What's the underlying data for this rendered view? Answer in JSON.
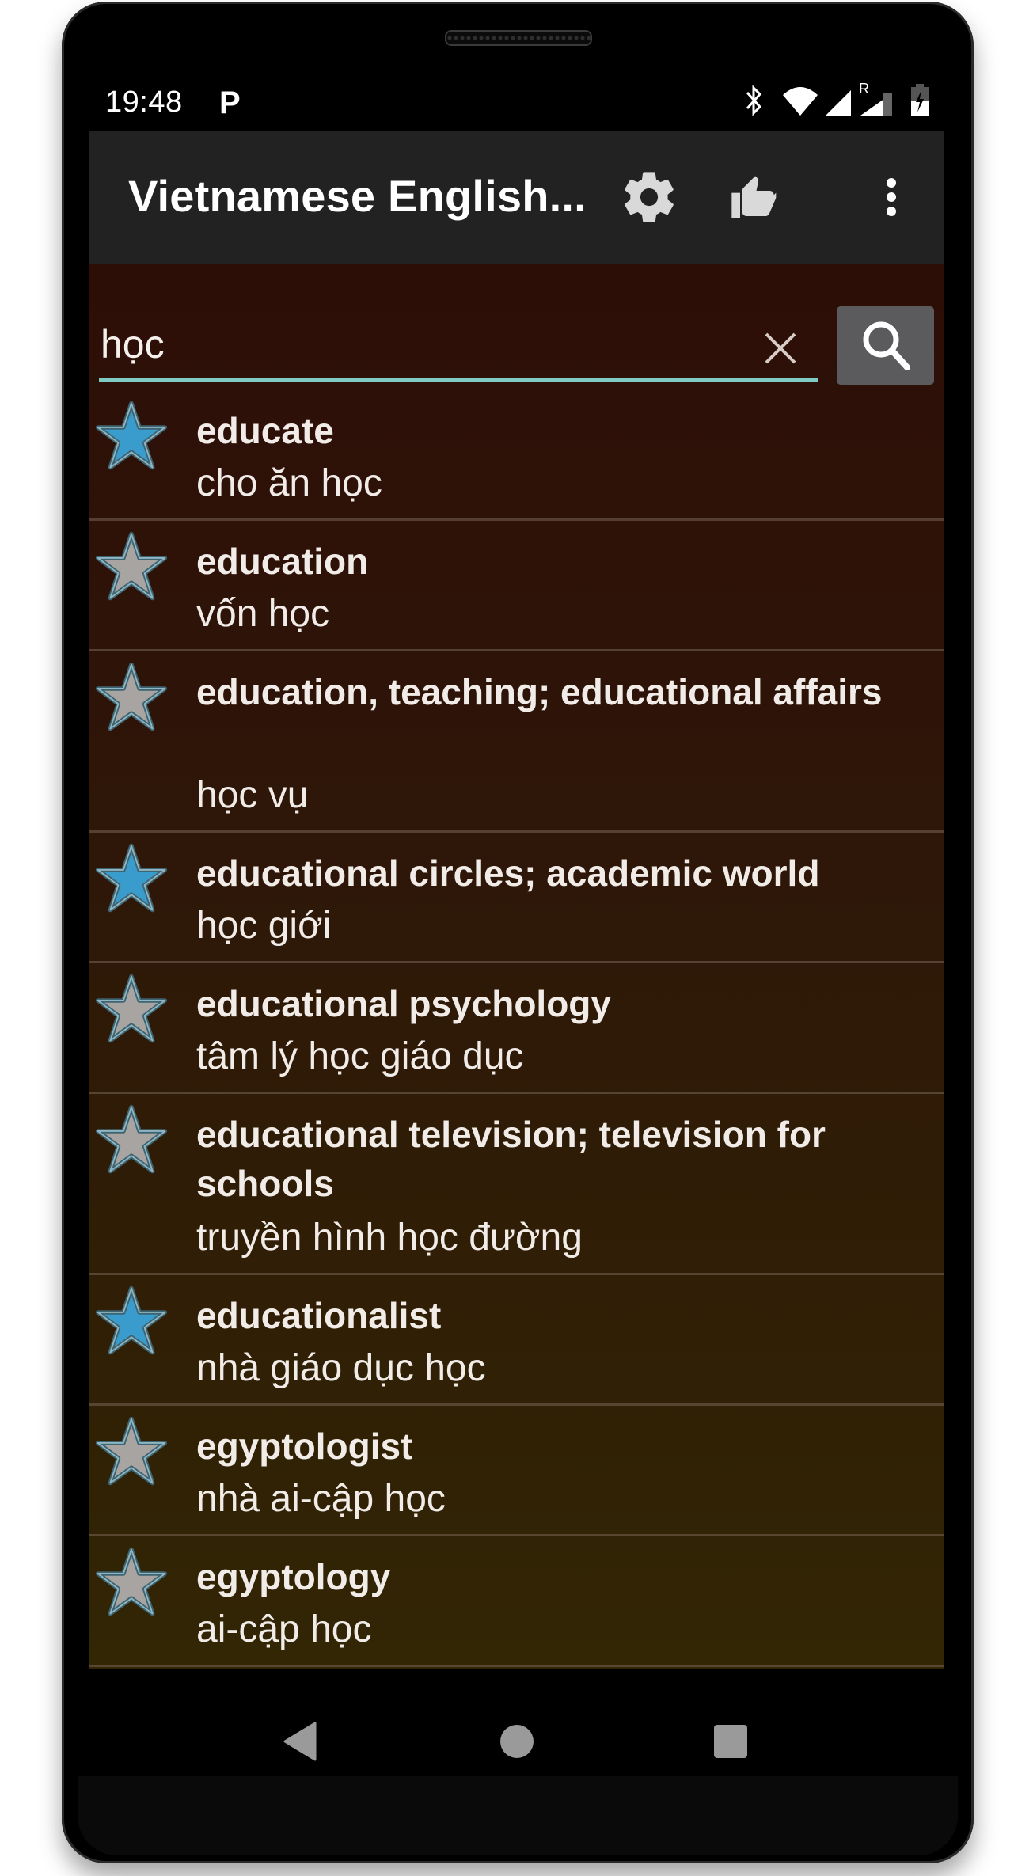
{
  "status_bar": {
    "time": "19:48",
    "notification_icon": "P",
    "icons": [
      "bluetooth-icon",
      "wifi-icon",
      "signal-icon",
      "roaming-signal-icon",
      "battery-charging-icon"
    ],
    "roaming_label": "R"
  },
  "toolbar": {
    "title": "Vietnamese English...",
    "actions": [
      "settings-icon",
      "thumbs-up-icon",
      "more-vert-icon"
    ]
  },
  "search": {
    "value": "học",
    "placeholder": "",
    "accent_color": "#80cbc4"
  },
  "colors": {
    "star_favorite": "#3a9bcd",
    "star_default": "#a8a4a1",
    "toolbar_bg": "#222222",
    "list_bg_top": "#2d0e07",
    "list_bg_bottom": "#322605"
  },
  "results": [
    {
      "word": "educate",
      "translation": "cho ăn học",
      "favorite": true
    },
    {
      "word": "education",
      "translation": "vốn học",
      "favorite": false
    },
    {
      "word": "education, teaching; educational affairs",
      "translation": "học vụ",
      "favorite": false
    },
    {
      "word": "educational circles; academic world",
      "translation": "học giới",
      "favorite": true
    },
    {
      "word": "educational psychology",
      "translation": "tâm lý học giáo dục",
      "favorite": false
    },
    {
      "word": "educational television; television for schools",
      "translation": "truyền hình học đường",
      "favorite": false
    },
    {
      "word": "educationalist",
      "translation": "nhà giáo dục học",
      "favorite": true
    },
    {
      "word": "egyptologist",
      "translation": "nhà ai-cập học",
      "favorite": false
    },
    {
      "word": "egyptology",
      "translation": "ai-cập học",
      "favorite": false
    }
  ],
  "nav": [
    "back-icon",
    "home-icon",
    "recents-icon"
  ]
}
